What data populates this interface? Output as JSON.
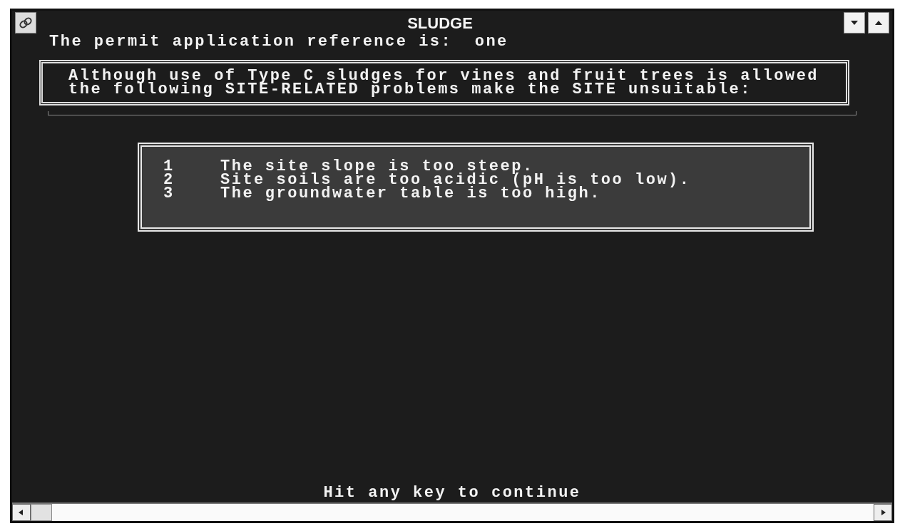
{
  "window": {
    "title": "SLUDGE"
  },
  "reference": {
    "label": "The permit application reference is:",
    "value": "one"
  },
  "message": {
    "lines": [
      "Although use of Type C sludges for vines and fruit trees is allowed",
      "the following SITE-RELATED problems make the SITE unsuitable:"
    ]
  },
  "problems": [
    {
      "number": "1",
      "text": "The site slope is too steep."
    },
    {
      "number": "2",
      "text": "Site soils are too acidic (pH is too low)."
    },
    {
      "number": "3",
      "text": "The groundwater table is too high."
    }
  ],
  "prompt": "Hit any key to continue"
}
